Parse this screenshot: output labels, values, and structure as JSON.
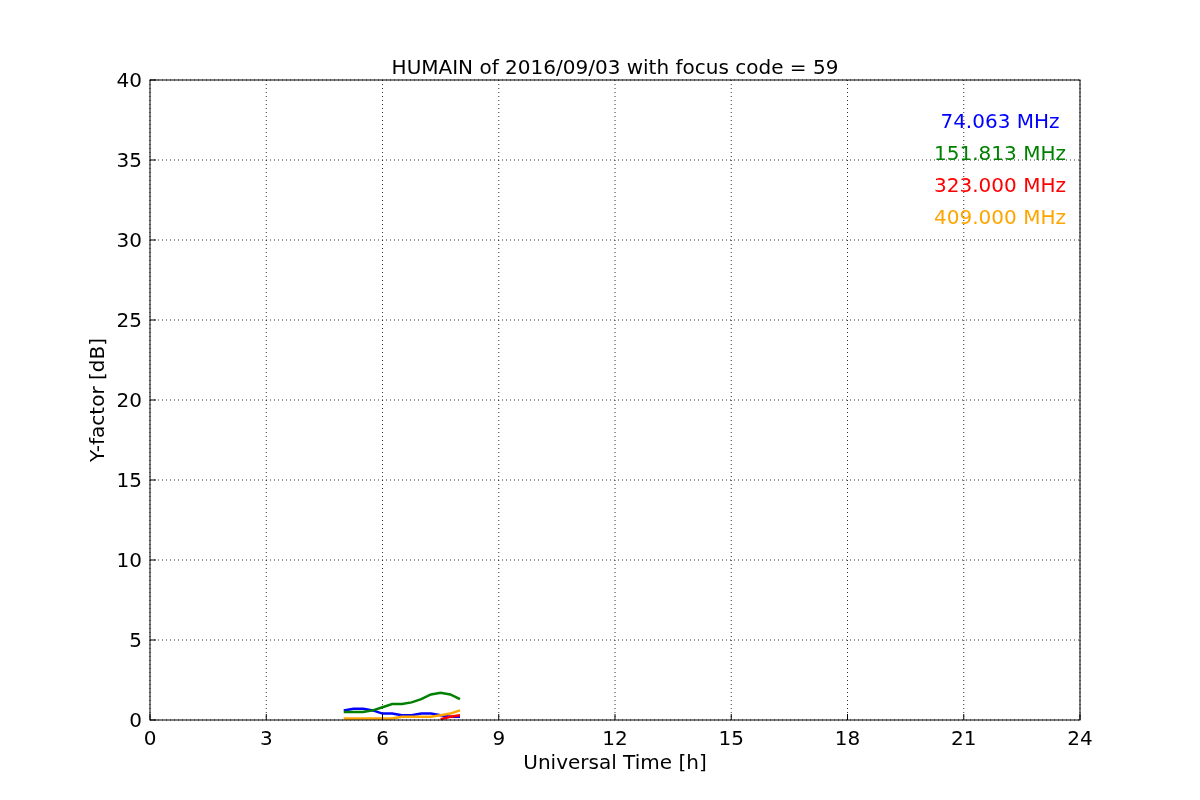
{
  "chart_data": {
    "type": "line",
    "title": "HUMAIN of 2016/09/03 with focus code = 59",
    "xlabel": "Universal Time [h]",
    "ylabel": "Y-factor [dB]",
    "x": [
      5,
      5.25,
      5.5,
      5.75,
      6,
      6.25,
      6.5,
      6.75,
      7,
      7.25,
      7.5,
      7.75,
      8
    ],
    "series": [
      {
        "name": "74.063 MHz",
        "color": "#0000ff",
        "values": [
          0.6,
          0.7,
          0.7,
          0.6,
          0.4,
          0.4,
          0.3,
          0.3,
          0.4,
          0.4,
          0.3,
          0.2,
          0.2
        ]
      },
      {
        "name": "151.813 MHz",
        "color": "#008000",
        "values": [
          0.5,
          0.5,
          0.5,
          0.6,
          0.8,
          1.0,
          1.0,
          1.1,
          1.3,
          1.6,
          1.7,
          1.6,
          1.3
        ]
      },
      {
        "name": "323.000 MHz",
        "color": "#ff0000",
        "values": [
          null,
          null,
          null,
          null,
          null,
          null,
          null,
          null,
          null,
          null,
          0.05,
          0.2,
          0.3
        ]
      },
      {
        "name": "409.000 MHz",
        "color": "#ffa500",
        "values": [
          0.1,
          0.1,
          0.1,
          0.1,
          0.1,
          0.1,
          0.2,
          0.2,
          0.2,
          0.2,
          0.3,
          0.4,
          0.6
        ]
      }
    ],
    "grid": true,
    "xlim": [
      0,
      24
    ],
    "ylim": [
      0,
      40
    ],
    "xticks": [
      0,
      3,
      6,
      9,
      12,
      15,
      18,
      21,
      24
    ],
    "yticks": [
      0,
      5,
      10,
      15,
      20,
      25,
      30,
      35,
      40
    ]
  }
}
